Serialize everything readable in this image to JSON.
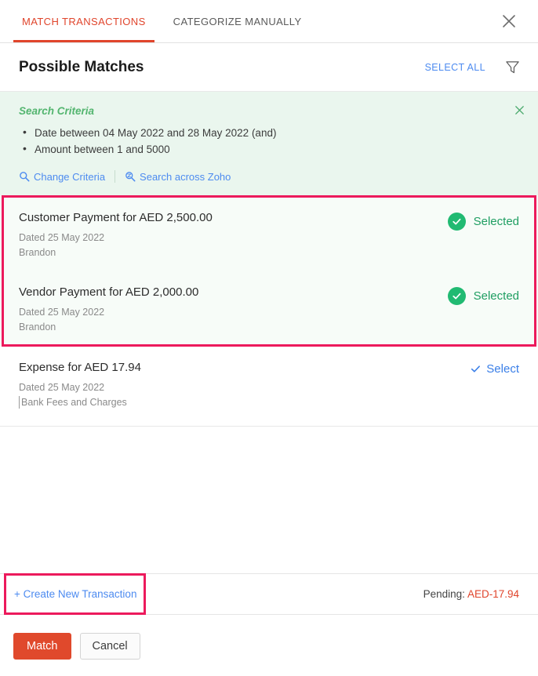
{
  "tabs": [
    {
      "label": "MATCH TRANSACTIONS",
      "active": true
    },
    {
      "label": "CATEGORIZE MANUALLY",
      "active": false
    }
  ],
  "header": {
    "title": "Possible Matches",
    "select_all_label": "SELECT ALL",
    "filter_icon": "filter-funnel-icon",
    "close_icon": "close-icon"
  },
  "search_criteria": {
    "title": "Search Criteria",
    "items": [
      "Date between 04 May 2022 and 28 May 2022  (and)",
      "Amount between 1 and 5000"
    ],
    "change_criteria_label": "Change Criteria",
    "change_criteria_icon": "search-icon",
    "search_zoho_label": "Search across Zoho",
    "search_zoho_icon": "search-zoho-icon",
    "close_icon": "close-icon"
  },
  "matches": [
    {
      "title": "Customer Payment for AED 2,500.00",
      "date": "Dated 25 May 2022",
      "party": "Brandon",
      "action_label": "Selected",
      "state": "selected",
      "action_icon": "check-circle-icon"
    },
    {
      "title": "Vendor Payment for AED 2,000.00",
      "date": "Dated 25 May 2022",
      "party": "Brandon",
      "action_label": "Selected",
      "state": "selected",
      "action_icon": "check-circle-icon"
    },
    {
      "title": "Expense for AED 17.94",
      "date": "Dated 25 May 2022",
      "party": "Bank Fees and Charges",
      "action_label": "Select",
      "state": "unselected",
      "action_icon": "check-icon"
    }
  ],
  "footer": {
    "create_new_label": "+ Create New Transaction",
    "pending_label": "Pending:",
    "pending_amount": "AED-17.94",
    "match_label": "Match",
    "cancel_label": "Cancel"
  },
  "colors": {
    "accent_red": "#e0452c",
    "highlight_pink": "#ec1a5c",
    "link_blue": "#4d8bf0",
    "success_green": "#21ba72",
    "criteria_bg": "#eaf6ee"
  }
}
